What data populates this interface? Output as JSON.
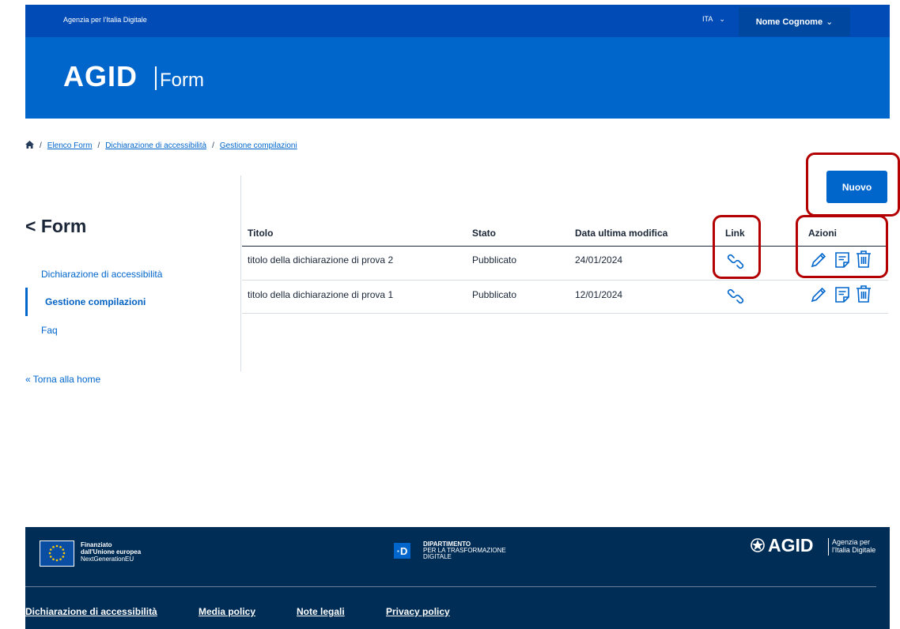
{
  "topbar": {
    "agency": "Agenzia per l'Italia Digitale",
    "language": "ITA",
    "user": "Nome Cognome"
  },
  "header": {
    "logo_main": "AGID",
    "logo_sub": "Form"
  },
  "breadcrumb": {
    "items": [
      "Elenco Form",
      "Dichiarazione di accessibilità",
      "Gestione compilazioni"
    ]
  },
  "sidebar": {
    "title": "< Form",
    "items": [
      {
        "label": "Dichiarazione di accessibilità"
      },
      {
        "label": "Gestione compilazioni"
      },
      {
        "label": "Faq"
      }
    ],
    "back_home": "« Torna alla home"
  },
  "toolbar": {
    "new_label": "Nuovo"
  },
  "table": {
    "headers": [
      "Titolo",
      "Stato",
      "Data ultima modifica",
      "Link",
      "Azioni"
    ],
    "rows": [
      {
        "title": "titolo della dichiarazione di prova 2",
        "status": "Pubblicato",
        "date": "24/01/2024"
      },
      {
        "title": "titolo della dichiarazione di prova 1",
        "status": "Pubblicato",
        "date": "12/01/2024"
      }
    ]
  },
  "footer": {
    "eu": {
      "line1": "Finanziato",
      "line2": "dall'Unione europea",
      "line3": "NextGenerationEU"
    },
    "dept": {
      "badge": "·D",
      "line1": "DIPARTIMENTO",
      "line2": "PER LA TRASFORMAZIONE",
      "line3": "DIGITALE"
    },
    "agid": {
      "name": "AGID",
      "line1": "Agenzia per",
      "line2": "l'Italia Digitale"
    },
    "links": [
      "Dichiarazione di accessibilità",
      "Media policy",
      "Note legali",
      "Privacy policy"
    ]
  },
  "colors": {
    "primary": "#0066cc",
    "topbar": "#004bb6",
    "footer": "#002d56",
    "highlight": "#b30000"
  }
}
